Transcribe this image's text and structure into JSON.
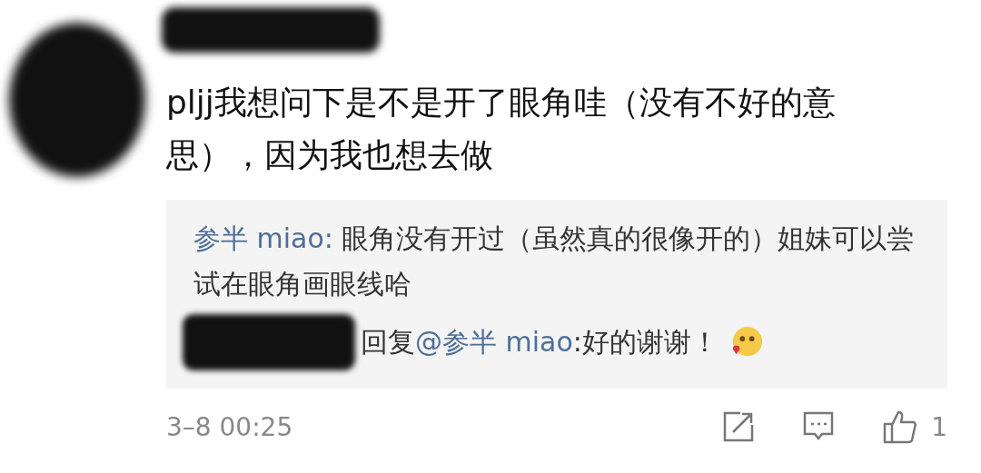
{
  "comment": {
    "text": "pljj我想问下是不是开了眼角哇（没有不好的意思），因为我也想去做"
  },
  "replies": [
    {
      "kind": "reply",
      "author": "参半 miao:",
      "text": " 眼角没有开过（虽然真的很像开的）姐妹可以尝试在眼角画眼线哈"
    },
    {
      "kind": "response",
      "prefix": "回复",
      "mention": "@参半 miao",
      "text": ":好的谢谢！"
    }
  ],
  "footer": {
    "time": "3–8 00:25",
    "like_count": "1"
  }
}
